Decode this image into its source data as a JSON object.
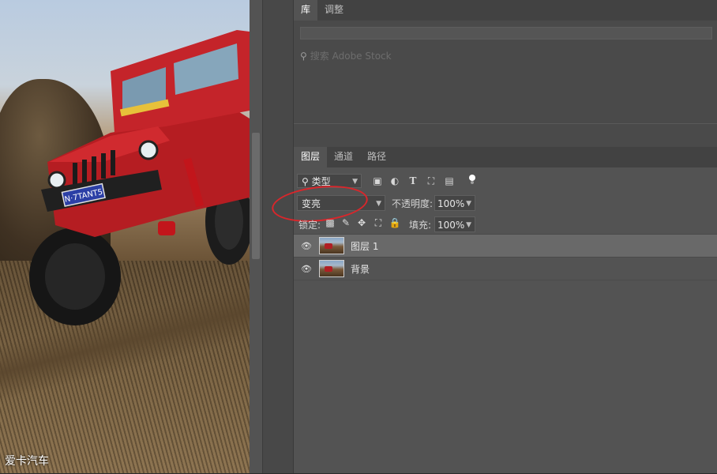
{
  "canvas": {
    "watermark": "爱卡汽车",
    "plate_text": "N·7TANT5"
  },
  "library_panel": {
    "tabs": [
      {
        "label": "库",
        "active": true
      },
      {
        "label": "调整",
        "active": false
      }
    ],
    "search_placeholder": "搜索 Adobe Stock"
  },
  "layers_panel": {
    "tabs": [
      {
        "label": "图层",
        "active": true
      },
      {
        "label": "通道",
        "active": false
      },
      {
        "label": "路径",
        "active": false
      }
    ],
    "filter_kind": "类型",
    "filter_icons": [
      "image-filter-icon",
      "adjustment-filter-icon",
      "type-filter-icon",
      "shape-filter-icon",
      "smart-object-filter-icon"
    ],
    "blend_mode": "变亮",
    "opacity_label": "不透明度:",
    "opacity_value": "100%",
    "lock_label": "锁定:",
    "lock_icons": [
      "lock-transparent-icon",
      "lock-image-icon",
      "lock-position-icon",
      "lock-artboard-icon",
      "lock-all-icon"
    ],
    "fill_label": "填充:",
    "fill_value": "100%",
    "layers": [
      {
        "name": "图层 1",
        "visible": true,
        "selected": true
      },
      {
        "name": "背景",
        "visible": true,
        "selected": false
      }
    ],
    "annotation_color": "#d9262b"
  }
}
